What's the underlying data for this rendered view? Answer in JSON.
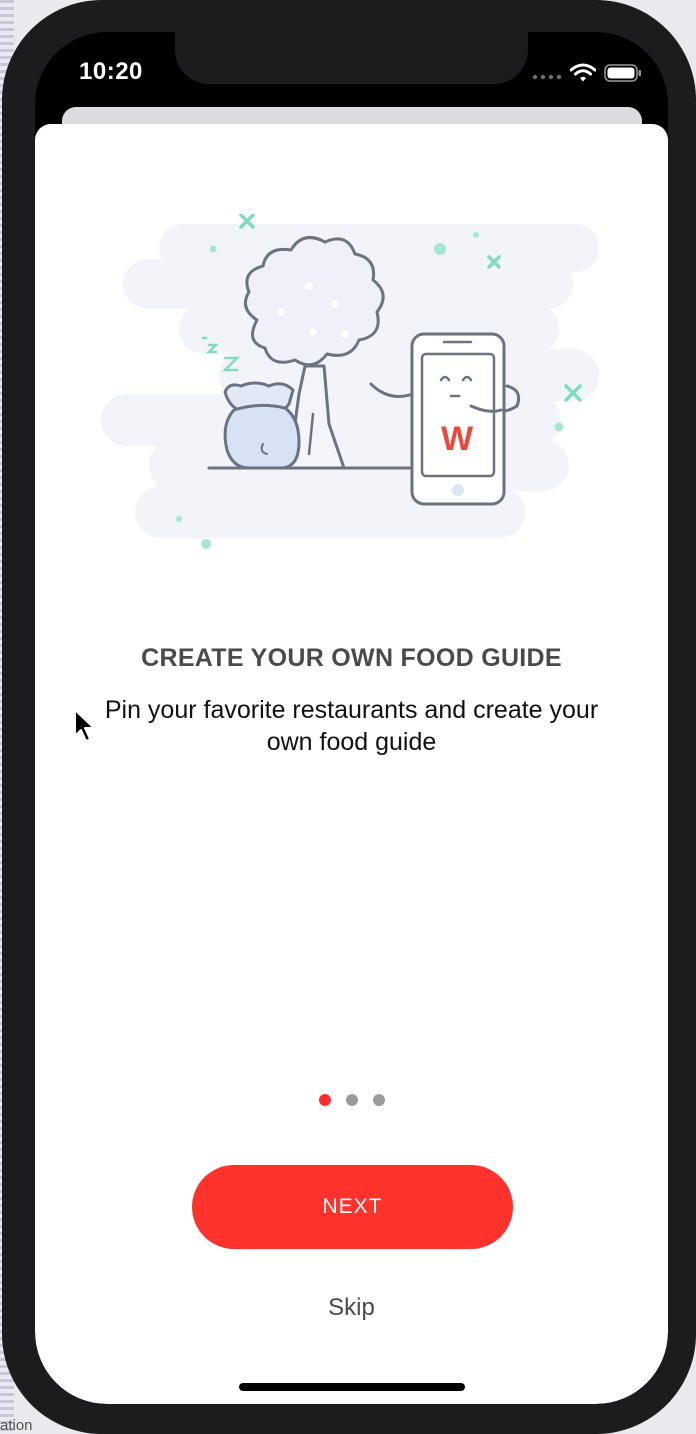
{
  "status_bar": {
    "time": "10:20",
    "icons": [
      "cellular-signal-icon",
      "wifi-icon",
      "battery-icon"
    ]
  },
  "onboarding": {
    "title": "CREATE YOUR OWN FOOD GUIDE",
    "description": "Pin your favorite restaurants and create your own food guide",
    "illustration": "phone-mascot-under-tree-illustration",
    "logo_letter": "W",
    "pager": {
      "pages": 3,
      "current": 1
    },
    "next_label": "NEXT",
    "skip_label": "Skip"
  },
  "desktop": {
    "caption": "ation"
  },
  "colors": {
    "accent": "#ff322c",
    "pager_active": "#ff2d2d",
    "pager_inactive": "#9b9b9b",
    "title": "#4a4a4a",
    "illustration_mint": "#7fdcc0"
  }
}
